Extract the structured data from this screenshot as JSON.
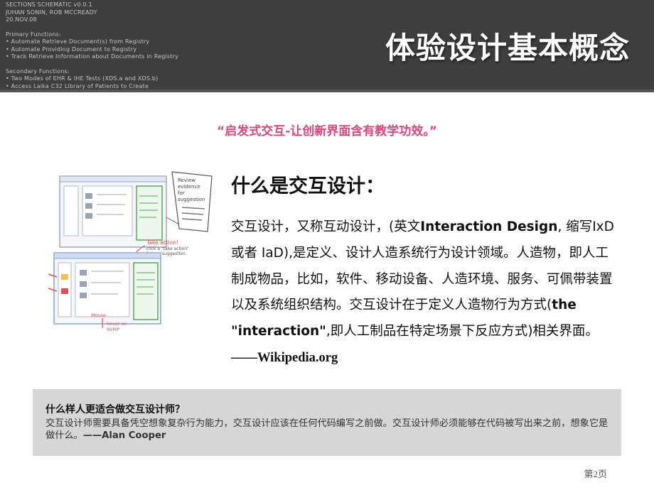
{
  "header": {
    "notes": {
      "line1": "SECTIONS SCHEMATIC v0.0.1",
      "line2": "JUHAN SONIN, ROB MCCREADY",
      "line3": "20.NOV.08",
      "primary_heading": "Primary Functions:",
      "primary_items": [
        "• Automate Retrieve Document(s) from Registry",
        "• Automate Providing Document to Registry",
        "• Track Retrieve Information about Documents in Registry"
      ],
      "secondary_heading": "Secondary Functions:",
      "secondary_items": [
        "• Two Modes of EHR & IHE Tests (XDS.a and XDS.b)",
        "• Access Laika C32 Library of Patients to Create"
      ]
    },
    "title": "体验设计基本概念"
  },
  "quote": "“启发式交互-让创新界面含有教学功效。”",
  "section": {
    "title": "什么是交互设计：",
    "body": {
      "p1": "交互设计，又称互动设计，(英文",
      "p2": "Interaction Design",
      "p3": ", 缩写IxD 或者 IaD),是定义、设计人造系统行为设计领域。人造物，即人工制成物品，比如，软件、移动设备、人造环境、服务、可佩带装置以及系统组织结构。交互设计在于定义人造物行为方式(",
      "p4": "the \"interaction\"",
      "p5": ",即人工制品在特定场景下反应方式)相关界面。",
      "p6": "——Wikipedia.org"
    }
  },
  "sketch": {
    "note_top": [
      "Review",
      "evidence",
      "for",
      "suggestion"
    ],
    "note_mid": [
      "Take action!",
      "click a \"take action\"",
      "link on suggestion"
    ],
    "note_bottom": [
      "Mouse",
      "hover on",
      "RVMP"
    ]
  },
  "callout": {
    "title": "什么样人更适合做交互设计师？",
    "text": "交互设计师需要具备凭空想象复杂行为能力，交互设计应该在任何代码编写之前做。交互设计师必须能够在代码被写出来之前，想象它是做什么。",
    "author": "——Alan Cooper"
  },
  "page_number": "第2页",
  "colors": {
    "header_bg": "#3e3e3e",
    "quote": "#e0457b",
    "callout_bg": "#d6d6d6",
    "sketch_green": "#4aa84a",
    "sketch_red": "#e05050",
    "sketch_blue": "#7f9cd0"
  }
}
